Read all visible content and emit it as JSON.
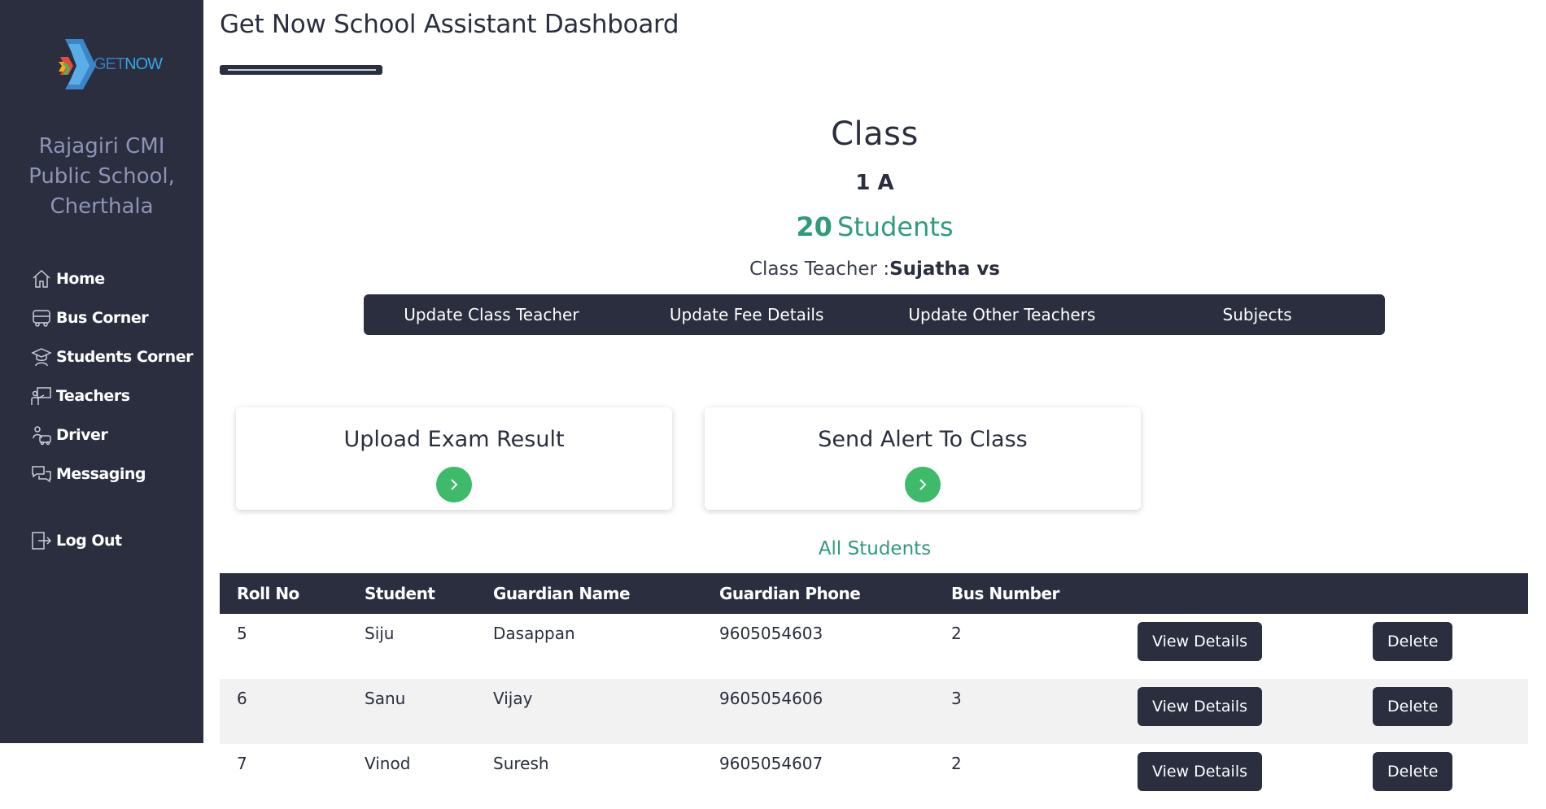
{
  "sidebar": {
    "logo": {
      "part1": "GET",
      "part2": "NOW"
    },
    "school_name_lines": [
      "Rajagiri CMI",
      "Public School,",
      "Cherthala"
    ],
    "nav": [
      {
        "label": "Home",
        "icon": "home-icon"
      },
      {
        "label": "Bus Corner",
        "icon": "bus-icon"
      },
      {
        "label": "Students Corner",
        "icon": "graduate-icon"
      },
      {
        "label": "Teachers",
        "icon": "teacher-icon"
      },
      {
        "label": "Driver",
        "icon": "driver-icon"
      },
      {
        "label": "Messaging",
        "icon": "messaging-icon"
      }
    ],
    "logout": {
      "label": "Log Out",
      "icon": "logout-icon"
    }
  },
  "header": {
    "title": "Get Now School Assistant Dashboard"
  },
  "class_info": {
    "heading": "Class",
    "name": "1 A",
    "student_count": "20",
    "students_label": "Students",
    "teacher_prefix": "Class Teacher :",
    "teacher_name": "Sujatha vs"
  },
  "actions": [
    "Update Class Teacher",
    "Update Fee Details",
    "Update Other Teachers",
    "Subjects"
  ],
  "cards": [
    {
      "title": "Upload Exam Result",
      "icon": "chevron-right-icon"
    },
    {
      "title": "Send Alert To Class",
      "icon": "chevron-right-icon"
    }
  ],
  "students_section": {
    "title": "All Students",
    "columns": [
      "Roll No",
      "Student",
      "Guardian Name",
      "Guardian Phone",
      "Bus Number",
      "",
      ""
    ],
    "view_label": "View Details",
    "delete_label": "Delete",
    "rows": [
      {
        "roll": "5",
        "student": "Siju",
        "guardian": "Dasappan",
        "phone": "9605054603",
        "bus": "2"
      },
      {
        "roll": "6",
        "student": "Sanu",
        "guardian": "Vijay",
        "phone": "9605054606",
        "bus": "3"
      },
      {
        "roll": "7",
        "student": "Vinod",
        "guardian": "Suresh",
        "phone": "9605054607",
        "bus": "2"
      }
    ]
  },
  "colors": {
    "sidebar_bg": "#2a2e3f",
    "accent_green": "#2f9c79",
    "button_green": "#3dbb6b",
    "dark": "#2a2e3f"
  }
}
